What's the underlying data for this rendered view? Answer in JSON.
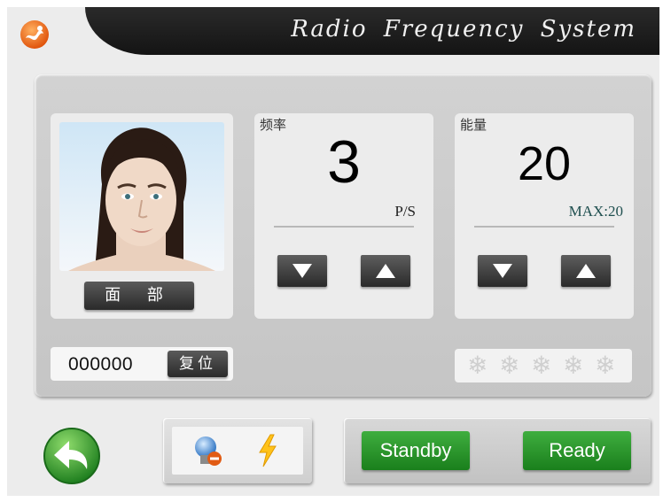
{
  "header": {
    "title": "Radio Frequency System",
    "logo_icon": "orange-logo-icon"
  },
  "treatment": {
    "area_label": "面 部",
    "photo": "face-photo"
  },
  "frequency": {
    "label": "频率",
    "value": "3",
    "unit": "P/S"
  },
  "energy": {
    "label": "能量",
    "value": "20",
    "max": "MAX:20"
  },
  "counter": {
    "value": "000000",
    "reset_label": "复位"
  },
  "cooling": {
    "icon": "snowflake-icon",
    "count": 5
  },
  "bottom": {
    "back_icon": "back-arrow-icon",
    "status_icons": [
      "bulb-warning-icon",
      "lightning-icon"
    ],
    "standby_label": "Standby",
    "ready_label": "Ready"
  },
  "colors": {
    "header": "#1c1c1c",
    "accent_green": "#2a9a2c",
    "panel": "#cbcbcb"
  }
}
